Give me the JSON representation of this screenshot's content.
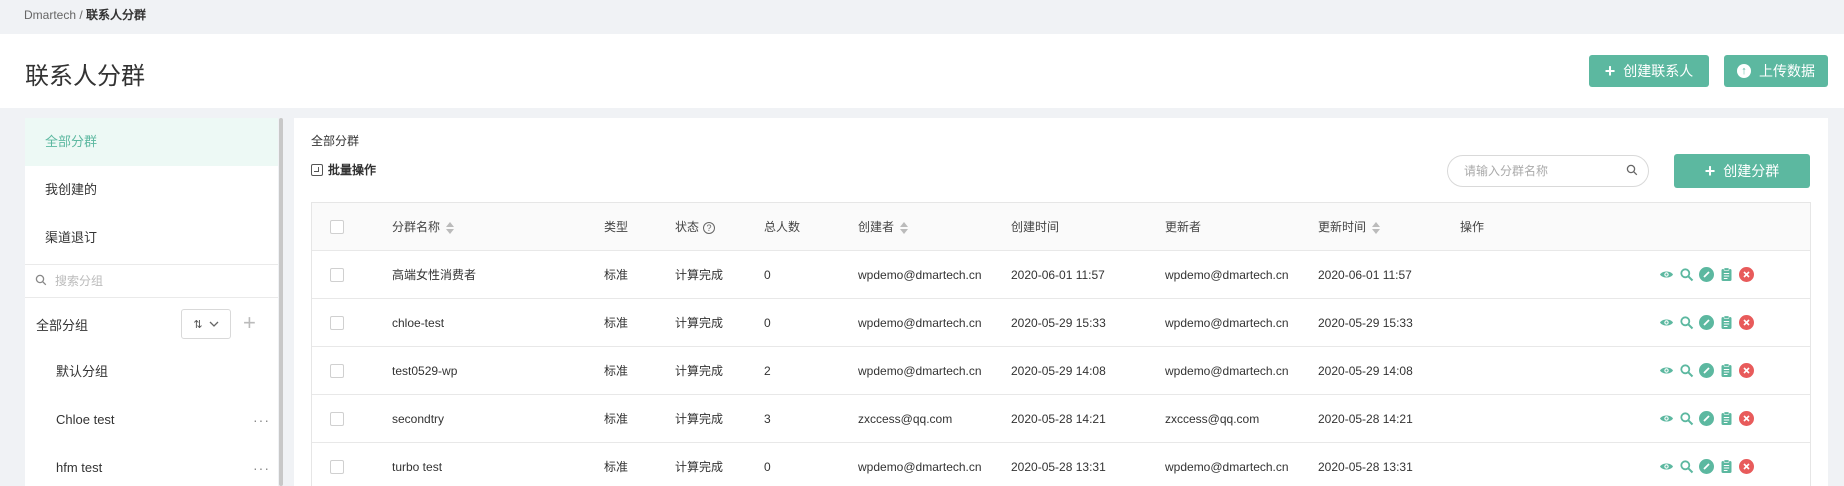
{
  "breadcrumb": {
    "root": "Dmartech",
    "separator": " / ",
    "current": "联系人分群"
  },
  "header": {
    "title": "联系人分群",
    "create_contact_label": "创建联系人",
    "upload_label": "上传数据"
  },
  "sidebar": {
    "items": [
      {
        "label": "全部分群",
        "active": true
      },
      {
        "label": "我创建的",
        "active": false
      },
      {
        "label": "渠道退订",
        "active": false
      }
    ],
    "search_placeholder": "搜索分组",
    "groups_title": "全部分组",
    "sort_glyph": "⇅",
    "groups": [
      {
        "label": "默认分组",
        "has_more": false
      },
      {
        "label": "Chloe test",
        "has_more": true
      },
      {
        "label": "hfm test",
        "has_more": true
      }
    ],
    "more_glyph": "···"
  },
  "main": {
    "section_label": "全部分群",
    "batch_label": "批量操作",
    "search_placeholder": "请输入分群名称",
    "create_segment_label": "创建分群",
    "columns": {
      "name": "分群名称",
      "type": "类型",
      "status": "状态",
      "total": "总人数",
      "creator": "创建者",
      "created_at": "创建时间",
      "updater": "更新者",
      "updated_at": "更新时间",
      "actions": "操作"
    },
    "rows": [
      {
        "name": "高端女性消费者",
        "type": "标准",
        "status": "计算完成",
        "total": "0",
        "creator": "wpdemo@dmartech.cn",
        "created_at": "2020-06-01 11:57",
        "updater": "wpdemo@dmartech.cn",
        "updated_at": "2020-06-01 11:57"
      },
      {
        "name": "chloe-test",
        "type": "标准",
        "status": "计算完成",
        "total": "0",
        "creator": "wpdemo@dmartech.cn",
        "created_at": "2020-05-29 15:33",
        "updater": "wpdemo@dmartech.cn",
        "updated_at": "2020-05-29 15:33"
      },
      {
        "name": "test0529-wp",
        "type": "标准",
        "status": "计算完成",
        "total": "2",
        "creator": "wpdemo@dmartech.cn",
        "created_at": "2020-05-29 14:08",
        "updater": "wpdemo@dmartech.cn",
        "updated_at": "2020-05-29 14:08"
      },
      {
        "name": "secondtry",
        "type": "标准",
        "status": "计算完成",
        "total": "3",
        "creator": "zxccess@qq.com",
        "created_at": "2020-05-28 14:21",
        "updater": "zxccess@qq.com",
        "updated_at": "2020-05-28 14:21"
      },
      {
        "name": "turbo test",
        "type": "标准",
        "status": "计算完成",
        "total": "0",
        "creator": "wpdemo@dmartech.cn",
        "created_at": "2020-05-28 13:31",
        "updater": "wpdemo@dmartech.cn",
        "updated_at": "2020-05-28 13:31"
      }
    ]
  },
  "colors": {
    "accent": "#5cb8a0",
    "danger": "#e85b5b",
    "active_bg": "#edf9f5",
    "page_bg": "#f0f2f5"
  },
  "icons": [
    "plus-icon",
    "upload-icon",
    "search-icon",
    "sort-icon",
    "batch-icon",
    "help-icon",
    "view-icon",
    "inspect-icon",
    "edit-icon",
    "copy-icon",
    "delete-icon",
    "more-icon"
  ]
}
